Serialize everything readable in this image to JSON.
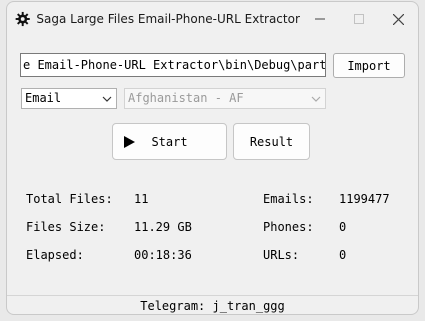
{
  "window": {
    "title": "Saga Large Files Email-Phone-URL Extractor",
    "icons": {
      "app": "gear-icon",
      "minimize": "minimize-icon",
      "maximize": "maximize-icon",
      "close": "close-icon"
    }
  },
  "path_input": {
    "value": "e Email-Phone-URL Extractor\\bin\\Debug\\parts"
  },
  "import_button": {
    "label": "Import"
  },
  "type_select": {
    "value": "Email"
  },
  "country_select": {
    "value": "Afghanistan - AF"
  },
  "start_button": {
    "label": "Start",
    "icon": "play-icon"
  },
  "result_button": {
    "label": "Result"
  },
  "stats": {
    "total_files_label": "Total Files:",
    "total_files_value": "11",
    "files_size_label": "Files Size:",
    "files_size_value": "11.29 GB",
    "elapsed_label": "Elapsed:",
    "elapsed_value": "00:18:36",
    "emails_label": "Emails:",
    "emails_value": "1199477",
    "phones_label": "Phones:",
    "phones_value": "0",
    "urls_label": "URLs:",
    "urls_value": "0"
  },
  "footer": {
    "text": "Telegram: j_tran_ggg"
  }
}
